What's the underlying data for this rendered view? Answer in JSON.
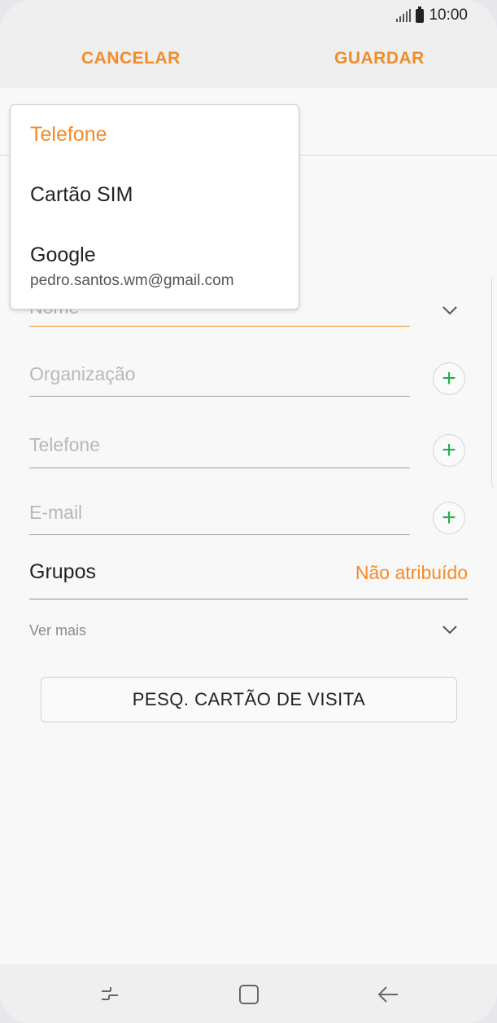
{
  "status": {
    "time": "10:00",
    "signal_icon": "signal-icon",
    "battery_icon": "battery-icon"
  },
  "actionbar": {
    "cancel_label": "CANCELAR",
    "save_label": "GUARDAR"
  },
  "form": {
    "name_placeholder": "Nome",
    "organization_placeholder": "Organização",
    "phone_placeholder": "Telefone",
    "email_placeholder": "E-mail",
    "groups_label": "Grupos",
    "groups_value": "Não atribuído",
    "see_more_label": "Ver mais",
    "scan_card_label": "PESQ. CARTÃO DE VISITA"
  },
  "dropdown": {
    "items": [
      {
        "title": "Telefone",
        "selected": true
      },
      {
        "title": "Cartão SIM"
      },
      {
        "title": "Google",
        "subtitle": "pedro.santos.wm@gmail.com"
      }
    ]
  },
  "colors": {
    "accent": "#f28c28",
    "plus_green": "#21b14a"
  }
}
